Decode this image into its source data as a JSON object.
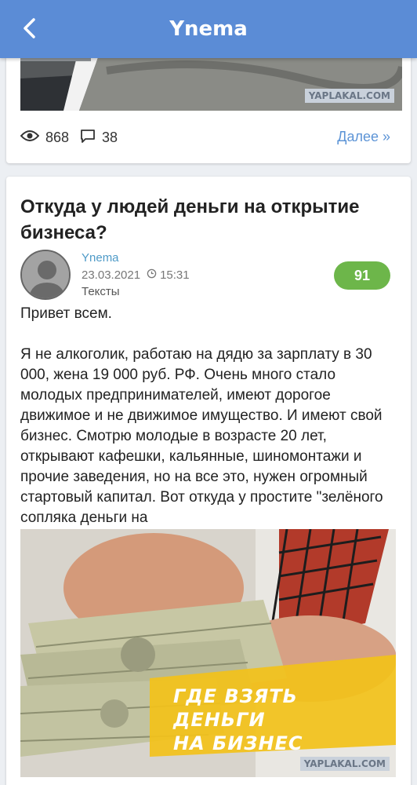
{
  "header": {
    "title": "Ynema",
    "back_icon": "chevron-left-icon",
    "bg_color": "#5b8cd6"
  },
  "prev_card": {
    "image_watermark": "YAPLAKAL.COM",
    "views": "868",
    "comments": "38",
    "more_label": "Далее »"
  },
  "post": {
    "title": "Откуда у людей деньги на открытие бизнеса?",
    "author": "Ynema",
    "date": "23.03.2021",
    "time": "15:31",
    "category": "Тексты",
    "rating": "91",
    "greeting": "Привет всем.",
    "body": "Я не алкоголик, работаю на дядю за зарплату в 30 000, жена 19 000 руб. РФ. Очень много стало молодых предпринимателей, имеют дорогое движимое и не движимое имущество. И имеют свой бизнес. Смотрю молодые в возрасте 20 лет, открывают кафешки, кальянные, шиномонтажи и прочие заведения, но на все это, нужен огромный стартовый капитал. Вот откуда у простите \"зелёного сопляка деньги на",
    "image_caption_line1": "ГДЕ ВЗЯТЬ ДЕНЬГИ",
    "image_caption_line2": "НА БИЗНЕС",
    "image_watermark": "YAPLAKAL.COM"
  },
  "colors": {
    "accent_link": "#5d94d6",
    "author": "#4e9ac7",
    "rating_bg": "#6db64a",
    "caption_band": "#f2c21b"
  }
}
